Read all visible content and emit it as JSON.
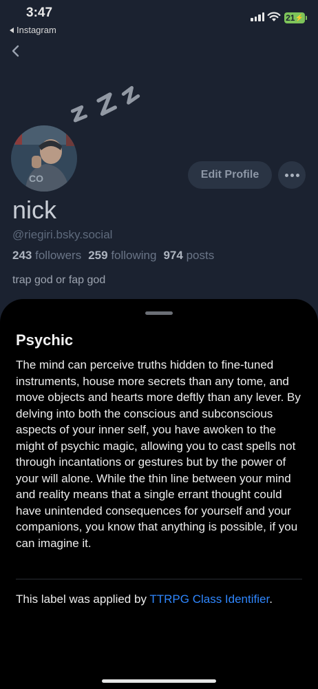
{
  "status_bar": {
    "time": "3:47",
    "back_app": "Instagram",
    "battery": "21"
  },
  "profile": {
    "edit_button": "Edit Profile",
    "display_name": "nick",
    "handle": "@riegiri.bsky.social",
    "followers_count": "243",
    "followers_label": "followers",
    "following_count": "259",
    "following_label": "following",
    "posts_count": "974",
    "posts_label": "posts",
    "bio": "trap god or fap god"
  },
  "sheet": {
    "title": "Psychic",
    "description": "The mind can perceive truths hidden to fine-tuned instruments, house more secrets than any tome, and move objects and hearts more deftly than any lever. By delving into both the conscious and subconscious aspects of your inner self, you have awoken to the might of psychic magic, allowing you to cast spells not through incantations or gestures but by the power of your will alone. While the thin line between your mind and reality means that a single errant thought could have unintended consequences for yourself and your companions, you know that anything is possible, if you can imagine it.",
    "attribution_prefix": "This label was applied by ",
    "attribution_link": "TTRPG Class Identifier",
    "attribution_suffix": "."
  },
  "colors": {
    "background_dim": "#1b2230",
    "sheet": "#000000",
    "link": "#2f87ff",
    "battery": "#7ec45a"
  },
  "icons": [
    "back-chevron-icon",
    "zzz-icon",
    "more-dots-icon",
    "signal-icon",
    "wifi-icon",
    "battery-icon"
  ]
}
